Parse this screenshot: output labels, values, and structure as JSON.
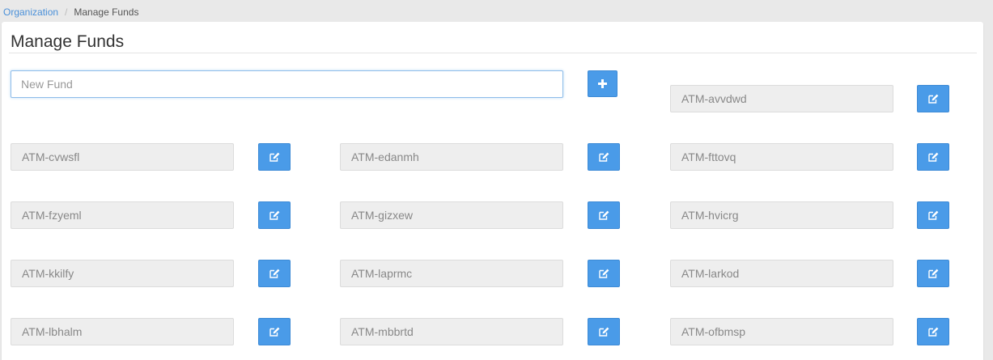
{
  "breadcrumb": {
    "parent": "Organization",
    "separator": "/",
    "current": "Manage Funds"
  },
  "page": {
    "title": "Manage Funds"
  },
  "new_fund": {
    "placeholder": "New Fund",
    "value": "",
    "add_icon": "plus-icon"
  },
  "edit_icon": "edit-icon",
  "funds": [
    "ATM-avvdwd",
    "ATM-cvwsfl",
    "ATM-edanmh",
    "ATM-fttovq",
    "ATM-fzyeml",
    "ATM-gizxew",
    "ATM-hvicrg",
    "ATM-kkilfy",
    "ATM-laprmc",
    "ATM-larkod",
    "ATM-lbhalm",
    "ATM-mbbrtd",
    "ATM-ofbmsp"
  ],
  "colors": {
    "accent": "#4a9be8",
    "link": "#4a90d9",
    "field_bg": "#eeeeee",
    "page_bg": "#e9e9e9"
  }
}
